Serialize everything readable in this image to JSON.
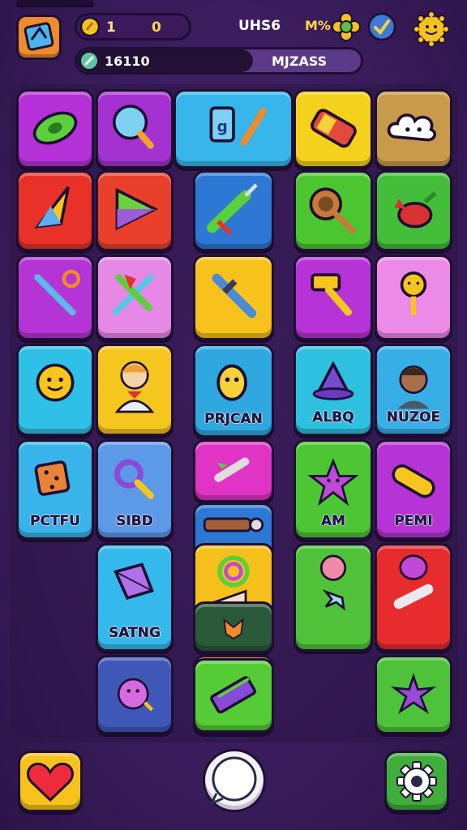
{
  "hud": {
    "coin_count": "1",
    "coin_count_2": "0",
    "level_label": "UHS6",
    "mult_label": "M%",
    "progress_label": "16110",
    "progress_fraction": 0.62,
    "bar_title": "MJZASS"
  },
  "tiles": [
    {
      "icon": "disc-icon",
      "color": "#b531d8",
      "label": ""
    },
    {
      "icon": "magnifier-icon",
      "color": "#a432d0",
      "label": ""
    },
    {
      "icon": "notebook-pencil-icon",
      "color": "#36b6ea",
      "label": ""
    },
    {
      "icon": "battery-icon",
      "color": "#f4d21c",
      "label": ""
    },
    {
      "icon": "cloud-face-icon",
      "color": "#c89a4a",
      "label": ""
    },
    {
      "icon": "arrow-cursor-icon",
      "color": "#e83229",
      "label": ""
    },
    {
      "icon": "play-triangle-icon",
      "color": "#e8402a",
      "label": ""
    },
    {
      "icon": "syringe-icon",
      "color": "#2c78d4",
      "label": ""
    },
    {
      "icon": "frying-pan-icon",
      "color": "#4cc630",
      "label": ""
    },
    {
      "icon": "bird-icon",
      "color": "#43bd3a",
      "label": ""
    },
    {
      "icon": "wrench-icon",
      "color": "#b534d6",
      "label": ""
    },
    {
      "icon": "crossed-tools-icon",
      "color": "#e688e6",
      "label": ""
    },
    {
      "icon": "sword-icon",
      "color": "#f7c21c",
      "label": ""
    },
    {
      "icon": "hammer-icon",
      "color": "#b633d8",
      "label": ""
    },
    {
      "icon": "smiley-key-icon",
      "color": "#ec8ae8",
      "label": ""
    },
    {
      "icon": "sun-face-icon",
      "color": "#2ec0e6",
      "label": ""
    },
    {
      "icon": "boy-avatar-icon",
      "color": "#f4c61e",
      "label": ""
    },
    {
      "icon": "banana-face-icon",
      "color": "#2fa8e0",
      "label": "PRJCAN"
    },
    {
      "icon": "wizard-hat-icon",
      "color": "#2ec0e0",
      "label": "ALBQ"
    },
    {
      "icon": "kid-avatar-icon",
      "color": "#38aee6",
      "label": "NUZOE"
    },
    {
      "icon": "dice-icon",
      "color": "#38b4ea",
      "label": "PCTFU"
    },
    {
      "icon": "key-loop-icon",
      "color": "#5c9ae8",
      "label": "SIBD"
    },
    {
      "icon": "rocket-icon",
      "color": "#e034c4",
      "label": ""
    },
    {
      "icon": "star-face-icon",
      "color": "#4cc632",
      "label": "AM"
    },
    {
      "icon": "capsule-icon",
      "color": "#b634d6",
      "label": "PEMI"
    },
    {
      "icon": "brick-flashlight-icon",
      "color": "#2c78d4",
      "label": ""
    },
    {
      "icon": "kite-icon",
      "color": "#35b9ec",
      "label": "SATNG"
    },
    {
      "icon": "ring-cone-icon",
      "color": "#f6c01c",
      "label": ""
    },
    {
      "icon": "virus-star-icon",
      "color": "#50c23a",
      "label": ""
    },
    {
      "icon": "blob-bottle-icon",
      "color": "#e62c2c",
      "label": ""
    },
    {
      "icon": "fox-face-icon",
      "color": "#2a5a3a",
      "label": ""
    },
    {
      "icon": "fluffy-face-icon",
      "color": "#3f58b8",
      "label": ""
    },
    {
      "icon": "bus-icon",
      "color": "#ef5a1f",
      "label": ""
    },
    {
      "icon": "striped-bar-icon",
      "color": "#55cc36",
      "label": ""
    },
    {
      "icon": "starfish-icon",
      "color": "#4ec23a",
      "label": ""
    },
    {
      "icon": "pill-icon",
      "color": "#f7d21a",
      "label": ""
    }
  ],
  "bottom_bar": {
    "heart_icon": "heart-icon",
    "chat_icon": "chat-bubble-icon",
    "settings_icon": "gear-icon"
  }
}
